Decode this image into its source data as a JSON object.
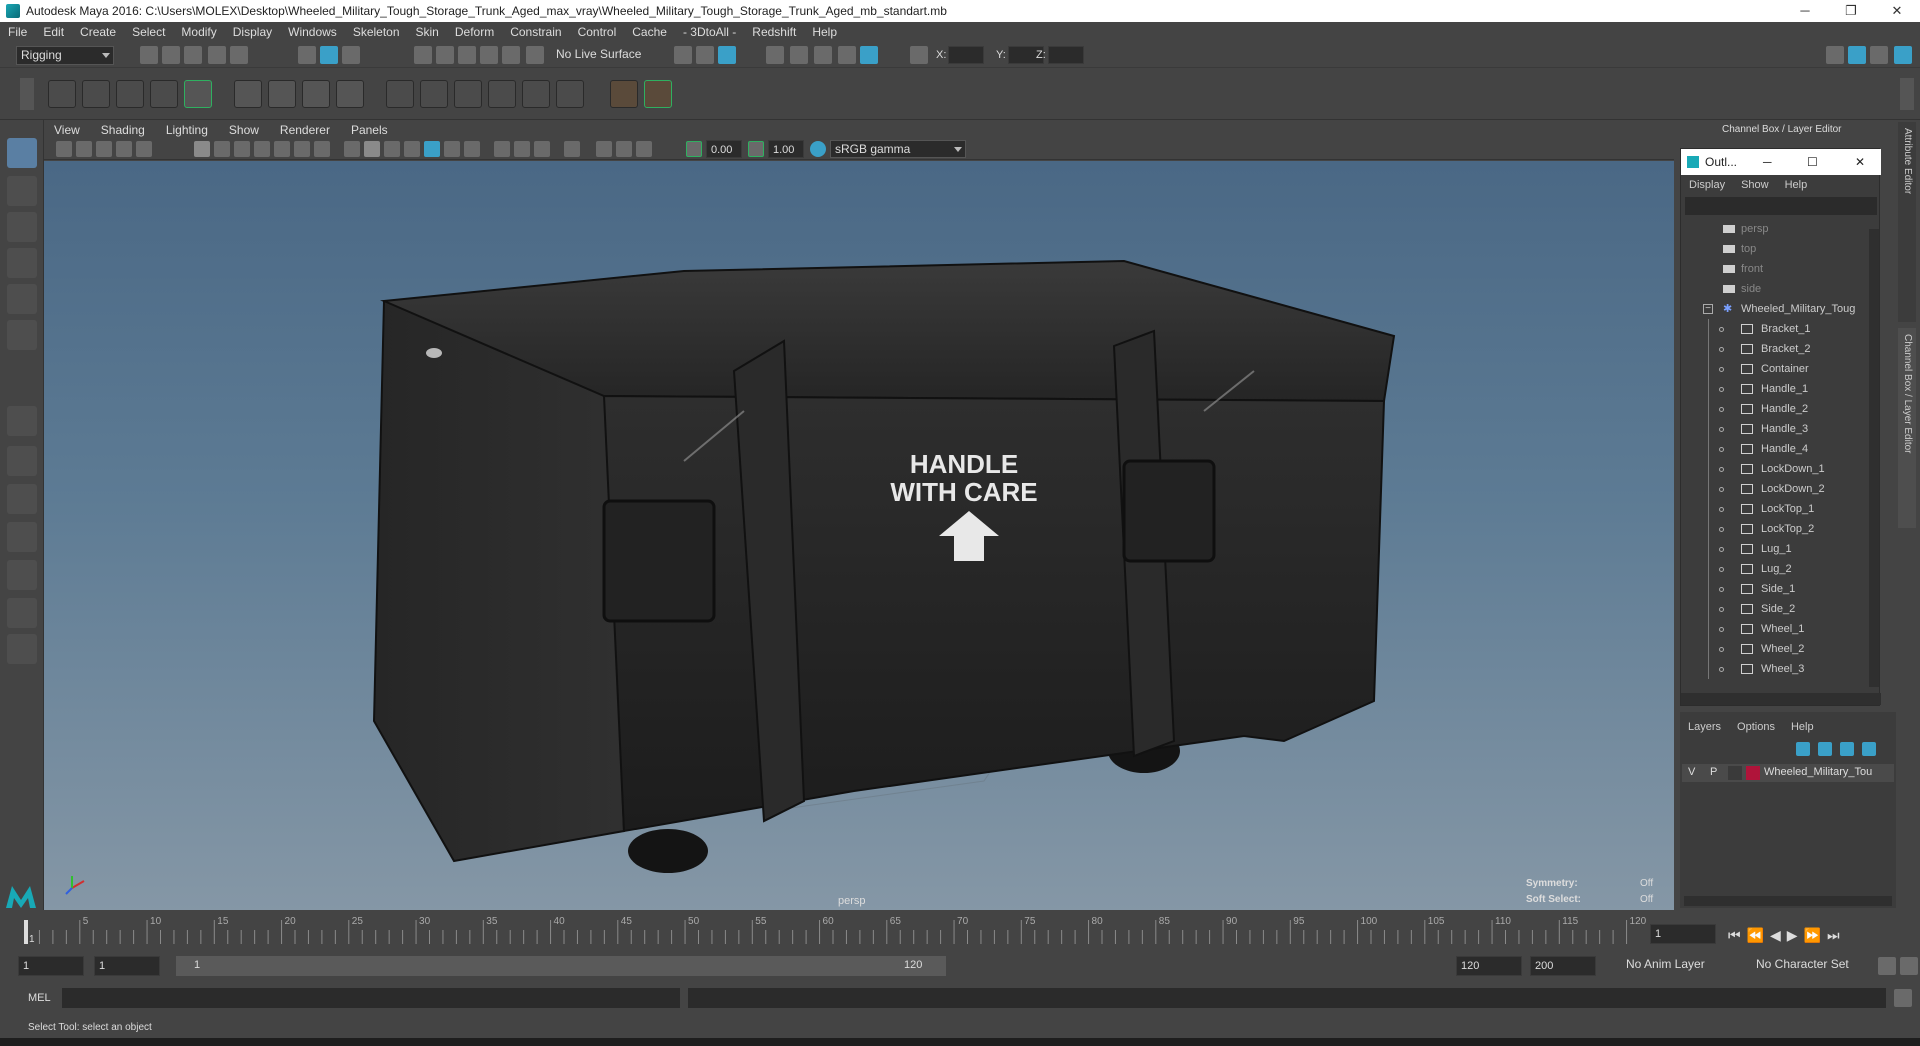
{
  "window": {
    "title": "Autodesk Maya 2016: C:\\Users\\MOLEX\\Desktop\\Wheeled_Military_Tough_Storage_Trunk_Aged_max_vray\\Wheeled_Military_Tough_Storage_Trunk_Aged_mb_standart.mb",
    "minimize": "─",
    "maximize": "❐",
    "close": "✕"
  },
  "menubar": [
    "File",
    "Edit",
    "Create",
    "Select",
    "Modify",
    "Display",
    "Windows",
    "Skeleton",
    "Skin",
    "Deform",
    "Constrain",
    "Control",
    "Cache",
    "- 3DtoAll -",
    "Redshift",
    "Help"
  ],
  "statusline": {
    "mode": "Rigging",
    "live_surface": "No Live Surface",
    "x_label": "X:",
    "y_label": "Y:",
    "z_label": "Z:"
  },
  "panel": {
    "menus": [
      "View",
      "Shading",
      "Lighting",
      "Show",
      "Renderer",
      "Panels"
    ],
    "exposure": "0.00",
    "gamma": "1.00",
    "color_space": "sRGB gamma"
  },
  "viewport": {
    "camera": "persp",
    "symmetry_label": "Symmetry:",
    "symmetry_value": "Off",
    "soft_select_label": "Soft Select:",
    "soft_select_value": "Off",
    "crate_text_line1": "HANDLE",
    "crate_text_line2": "WITH CARE"
  },
  "channelbox": {
    "title": "Channel Box / Layer Editor",
    "side_tab_1": "Attribute Editor",
    "side_tab_2": "Channel Box / Layer Editor"
  },
  "outliner": {
    "title": "Outl...",
    "menus": [
      "Display",
      "Show",
      "Help"
    ],
    "cameras": [
      "persp",
      "top",
      "front",
      "side"
    ],
    "root": "Wheeled_Military_Toug",
    "items": [
      "Bracket_1",
      "Bracket_2",
      "Container",
      "Handle_1",
      "Handle_2",
      "Handle_3",
      "Handle_4",
      "LockDown_1",
      "LockDown_2",
      "LockTop_1",
      "LockTop_2",
      "Lug_1",
      "Lug_2",
      "Side_1",
      "Side_2",
      "Wheel_1",
      "Wheel_2",
      "Wheel_3"
    ]
  },
  "layers": {
    "menus": [
      "Layers",
      "Options",
      "Help"
    ],
    "row": {
      "v": "V",
      "p": "P",
      "name": "Wheeled_Military_Tou",
      "color": "#b0143a"
    }
  },
  "timeline": {
    "ticks": [
      "5",
      "10",
      "15",
      "20",
      "25",
      "30",
      "35",
      "40",
      "45",
      "50",
      "55",
      "60",
      "65",
      "70",
      "75",
      "80",
      "85",
      "90",
      "95",
      "100",
      "105",
      "110",
      "115",
      "120"
    ],
    "start_marker": "1",
    "current_frame": "1"
  },
  "range": {
    "start": "1",
    "start2": "1",
    "slider_start": "1",
    "slider_end": "120",
    "end": "120",
    "end2": "200",
    "anim_layer": "No Anim Layer",
    "character_set": "No Character Set"
  },
  "cmdline": {
    "label": "MEL"
  },
  "helpline": {
    "text": "Select Tool: select an object"
  },
  "colors": {
    "accent": "#5285a6",
    "viewport_top": "#4a6885",
    "viewport_bottom": "#8597a6"
  }
}
